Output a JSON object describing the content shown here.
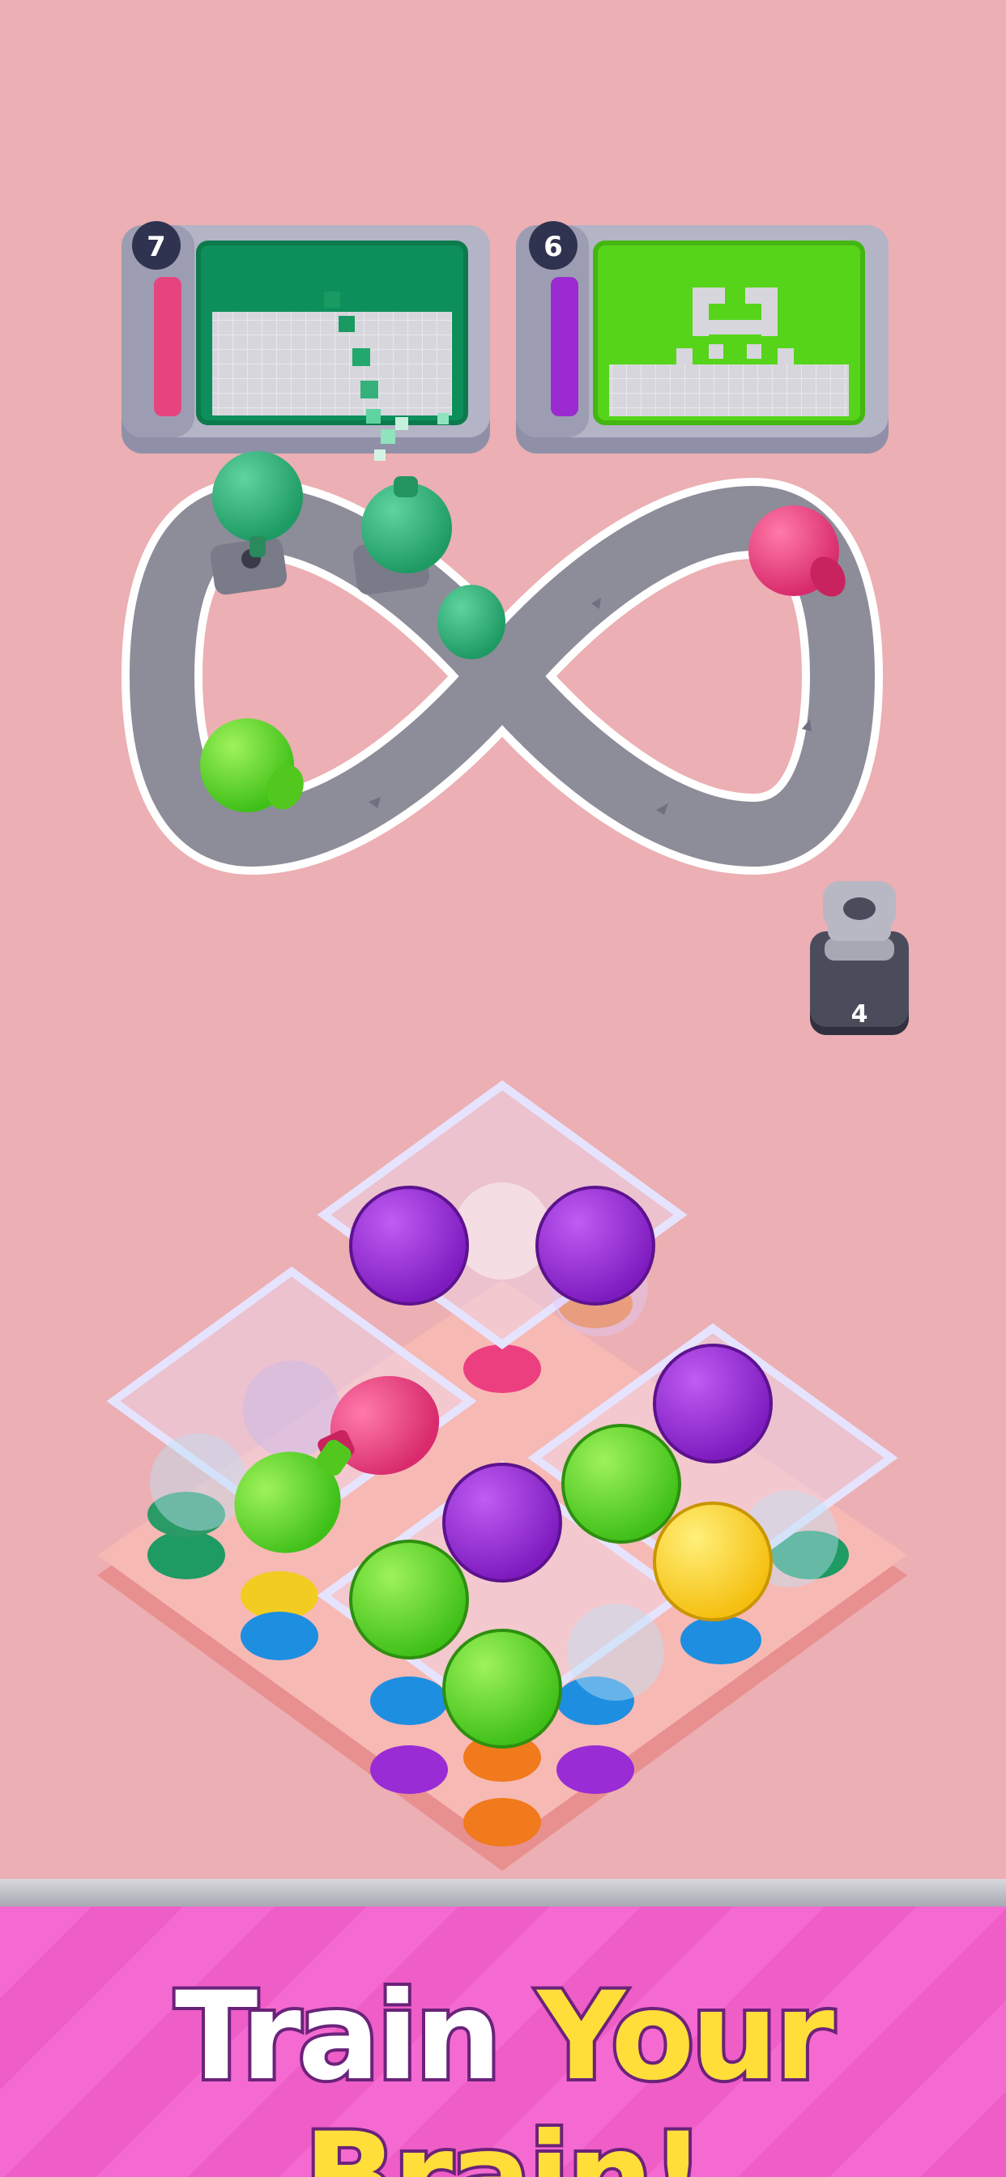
{
  "color_boxes": [
    {
      "count": "7",
      "canvas_color": "#0d8f5b",
      "canvas_border": "#0c7a4c",
      "indicator_color": "#e6447e"
    },
    {
      "count": "6",
      "canvas_color": "#56d41a",
      "canvas_border": "#44b612",
      "indicator_color": "#9b2ad1"
    }
  ],
  "stack_counter": {
    "count": "4"
  },
  "banner": {
    "word1": "Train",
    "word2": "Your",
    "word3": "Brain!"
  },
  "colors": {
    "background": "#ecafb3",
    "track": "#8c8d99",
    "dark_green": "#34b17a",
    "lime": "#6ee02a",
    "pink": "#ec3f80",
    "purple": "#9a2cd6",
    "yellow": "#ffd82e",
    "blue": "#1e8ee0",
    "orange": "#f07a1c"
  }
}
